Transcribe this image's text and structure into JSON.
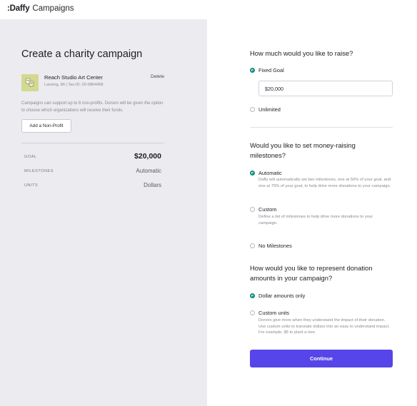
{
  "header": {
    "logo": ":Daffy",
    "product": "Campaigns"
  },
  "left": {
    "title": "Create a charity campaign",
    "nonprofit": {
      "name": "Reach Studio Art Center",
      "location": "Lansing, MI | Tax-ID: 20-0864458",
      "delete_label": "Delete",
      "logo_icon": "theater-masks-icon"
    },
    "support_text": "Campaigns can support up to 6 non-profits. Donors will be given the option to choose which organizations will receive their funds.",
    "add_button": "Add a Non-Profit",
    "summary": [
      {
        "label": "GOAL",
        "value": "$20,000"
      },
      {
        "label": "MILESTONES",
        "value": "Automatic"
      },
      {
        "label": "UNITS",
        "value": "Dollars"
      }
    ]
  },
  "right": {
    "q1": {
      "question": "How much would you like to raise?",
      "fixed_label": "Fixed Goal",
      "fixed_selected": true,
      "input_value": "$20,000",
      "unlimited_label": "Unlimited",
      "unlimited_selected": false
    },
    "q2": {
      "question": "Would you like to set money-raising milestones?",
      "automatic_label": "Automatic",
      "automatic_desc": "Daffy will automatically set two milestones, one at 50% of your goal, and one at 75% of your goal, to help drive more donations to your campaign.",
      "custom_label": "Custom",
      "custom_desc": "Define a list of milestones to help drive more donations to your campaign.",
      "none_label": "No Milestones",
      "selected": "automatic"
    },
    "q3": {
      "question": "How would you like to represent donation amounts in your campaign?",
      "dollar_label": "Dollar amounts only",
      "custom_label": "Custom units",
      "custom_desc": "Donors give more when they understand the impact of their donation. Use custom units to translate dollars into an easy to understand impact. For example, $5 to plant a tree.",
      "selected": "dollar"
    },
    "continue_label": "Continue"
  },
  "colors": {
    "accent": "#5645e8",
    "radio_selected": "#0f8a7f",
    "left_panel_bg": "#ecebef",
    "logo_bg": "#d3d98f"
  }
}
